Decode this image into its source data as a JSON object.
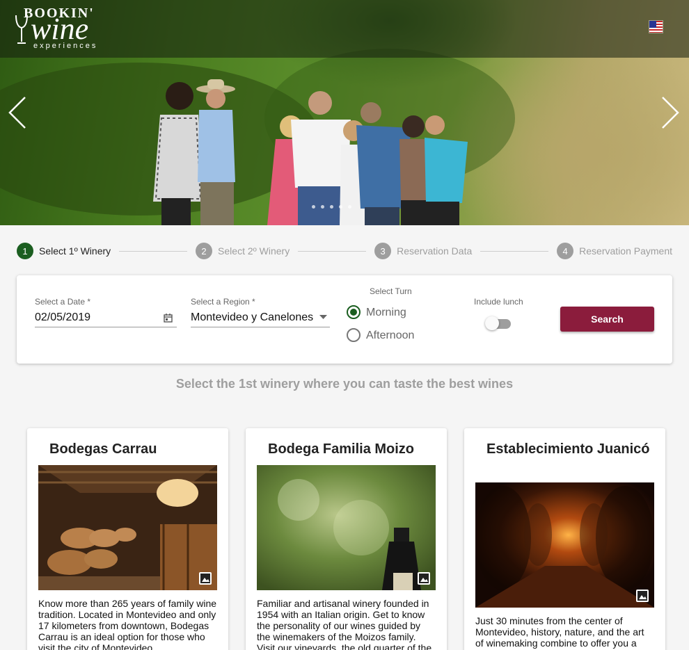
{
  "brand": {
    "logo_top": "BOOKIN'",
    "logo_main": "wine",
    "logo_sub": "experiences"
  },
  "header": {
    "language_icon": "us-flag-icon"
  },
  "carousel": {
    "prev_icon": "chevron-left-icon",
    "next_icon": "chevron-right-icon",
    "slide_count": 5,
    "active_slide": 1
  },
  "stepper": {
    "steps": [
      {
        "num": "1",
        "label": "Select 1º Winery",
        "active": true
      },
      {
        "num": "2",
        "label": "Select 2º Winery",
        "active": false
      },
      {
        "num": "3",
        "label": "Reservation Data",
        "active": false
      },
      {
        "num": "4",
        "label": "Reservation Payment",
        "active": false
      }
    ]
  },
  "search": {
    "date_label": "Select a Date *",
    "date_value": "02/05/2019",
    "region_label": "Select a Region *",
    "region_value": "Montevideo y Canelones",
    "turn_title": "Select Turn",
    "turn_options": [
      "Morning",
      "Afternoon"
    ],
    "turn_selected": "Morning",
    "lunch_label": "Include lunch",
    "lunch_enabled": false,
    "search_label": "Search"
  },
  "headline": "Select the 1st winery where you can taste the best wines",
  "wineries": [
    {
      "name": "Bodegas Carrau",
      "description": "Know more than 265 years of family wine tradition. Located in Montevideo and only 17 kilometers from downtown, Bodegas Carrau is an ideal option for those who visit the city of Montevideo."
    },
    {
      "name": "Bodega Familia Moizo",
      "description": "Familiar and artisanal winery founded in 1954 with an Italian origin. Get to know the personality of our wines guided by the winemakers of the Moizos family. Visit our vineyards, the old quarter of the"
    },
    {
      "name": "Establecimiento Juanicó",
      "description": "Just 30 minutes from the center of Montevideo, history, nature, and the art of winemaking combine to offer you a"
    }
  ],
  "colors": {
    "accent_green": "#1b5e20",
    "button_wine": "#8b1c3c",
    "muted_text": "#9e9e9e"
  }
}
